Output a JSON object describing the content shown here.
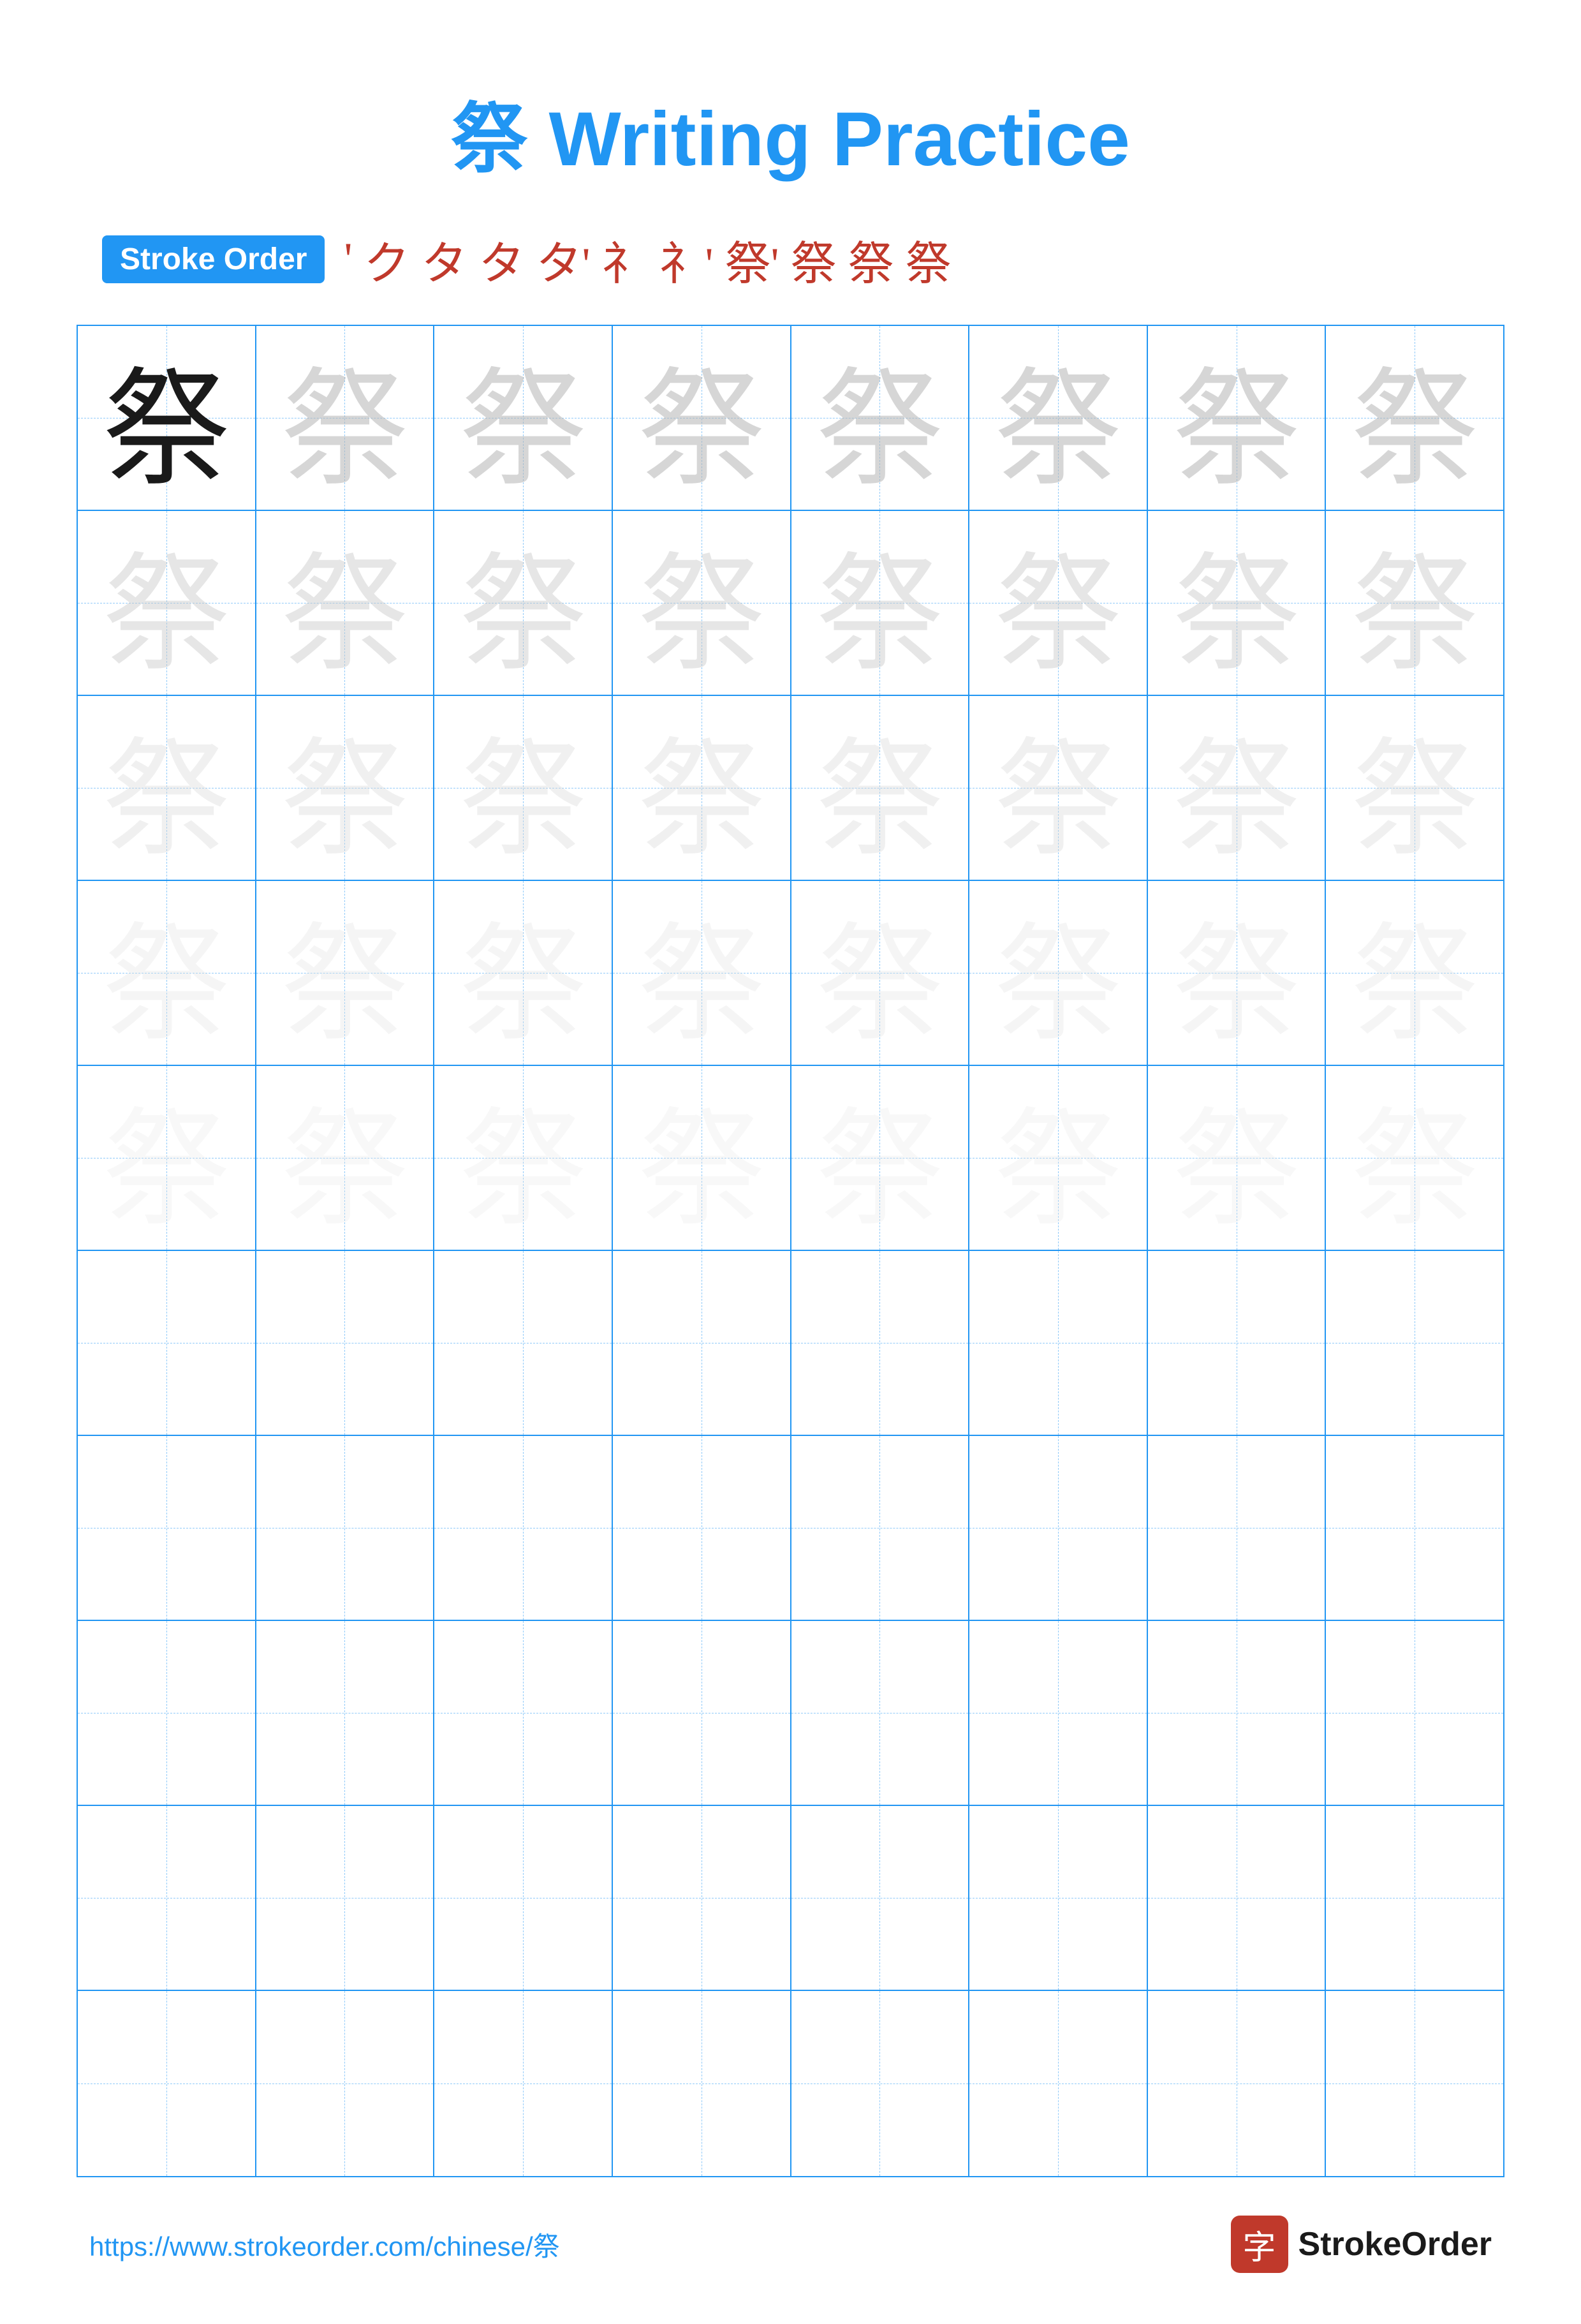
{
  "title": "祭 Writing Practice",
  "stroke_order_label": "Stroke Order",
  "stroke_order_chars": [
    "'",
    "ク",
    "タ",
    "タ",
    "タ'",
    "礻",
    "礻'",
    "祭'",
    "祭",
    "祭",
    "祭"
  ],
  "character": "祭",
  "rows_with_chars": 5,
  "cols": 8,
  "empty_rows": 5,
  "footer_url": "https://www.strokeorder.com/chinese/祭",
  "footer_logo_char": "字",
  "footer_logo_name": "StrokeOrder"
}
